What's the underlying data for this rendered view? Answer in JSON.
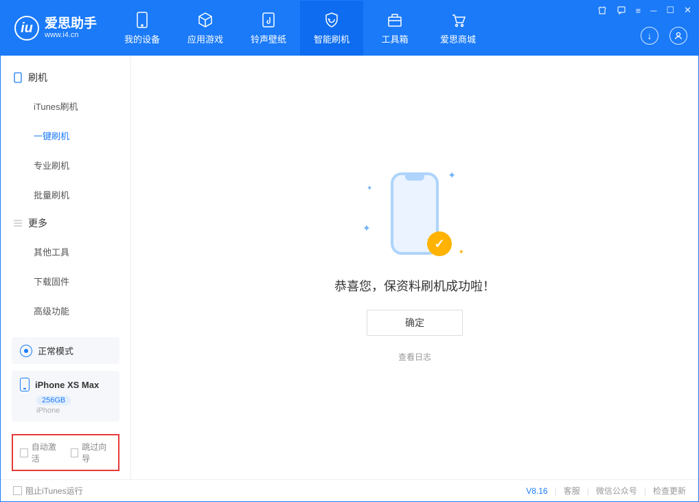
{
  "app": {
    "name": "爱思助手",
    "url": "www.i4.cn"
  },
  "nav": [
    {
      "label": "我的设备"
    },
    {
      "label": "应用游戏"
    },
    {
      "label": "铃声壁纸"
    },
    {
      "label": "智能刷机"
    },
    {
      "label": "工具箱"
    },
    {
      "label": "爱思商城"
    }
  ],
  "sidebar": {
    "section1": {
      "title": "刷机",
      "items": [
        "iTunes刷机",
        "一键刷机",
        "专业刷机",
        "批量刷机"
      ]
    },
    "section2": {
      "title": "更多",
      "items": [
        "其他工具",
        "下载固件",
        "高级功能"
      ]
    }
  },
  "device_status": "正常模式",
  "device": {
    "name": "iPhone XS Max",
    "capacity": "256GB",
    "type": "iPhone"
  },
  "options": {
    "auto_activate": "自动激活",
    "skip_guide": "跳过向导"
  },
  "main": {
    "message": "恭喜您，保资料刷机成功啦！",
    "confirm": "确定",
    "view_log": "查看日志"
  },
  "footer": {
    "block_itunes": "阻止iTunes运行",
    "version": "V8.16",
    "support": "客服",
    "wechat": "微信公众号",
    "update": "检查更新"
  }
}
